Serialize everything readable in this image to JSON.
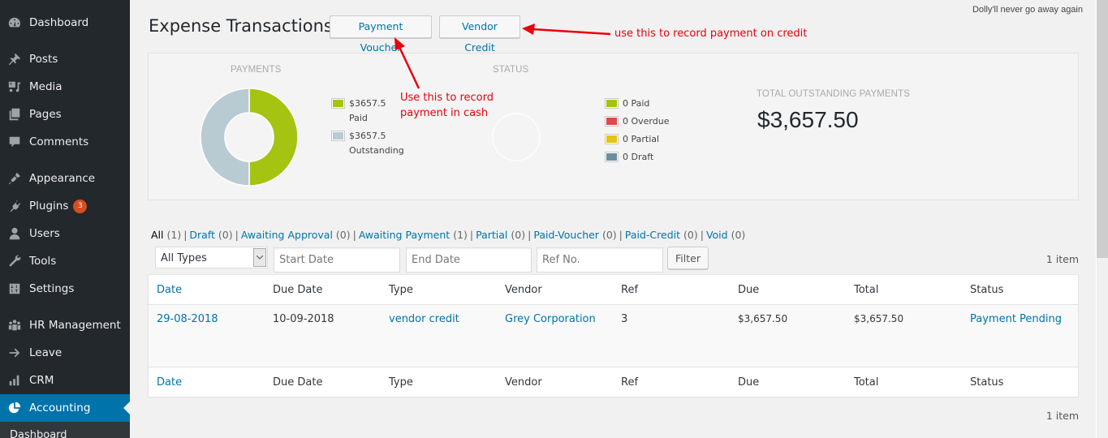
{
  "sidebar": {
    "items": [
      {
        "label": "Dashboard",
        "icon": "dashboard-icon"
      },
      {
        "label": "Posts",
        "icon": "pushpin-icon"
      },
      {
        "label": "Media",
        "icon": "media-icon"
      },
      {
        "label": "Pages",
        "icon": "pages-icon"
      },
      {
        "label": "Comments",
        "icon": "comment-icon"
      },
      {
        "label": "Appearance",
        "icon": "paintbrush-icon"
      },
      {
        "label": "Plugins",
        "icon": "plugin-icon",
        "badge": "3"
      },
      {
        "label": "Users",
        "icon": "user-icon"
      },
      {
        "label": "Tools",
        "icon": "wrench-icon"
      },
      {
        "label": "Settings",
        "icon": "sliders-icon"
      },
      {
        "label": "HR Management",
        "icon": "group-icon"
      },
      {
        "label": "Leave",
        "icon": "arrow-right-icon"
      },
      {
        "label": "CRM",
        "icon": "bar-chart-icon"
      },
      {
        "label": "Accounting",
        "icon": "pie-chart-icon",
        "active": true
      }
    ],
    "submenu_peek": "Dashboard"
  },
  "header": {
    "dolly_text": "Dolly'll never go away again",
    "title": "Expense Transactions",
    "buttons": {
      "payment_voucher": "Payment Voucher",
      "vendor_credit": "Vendor Credit"
    }
  },
  "annotations": {
    "credit": "use this to record payment on credit",
    "cash_line1": "Use this to record",
    "cash_line2": "payment in cash",
    "color": "#e8000b"
  },
  "summary": {
    "payments": {
      "title": "PAYMENTS",
      "legend": [
        {
          "amount": "$3657.5",
          "label": "Paid",
          "color": "#a4c411"
        },
        {
          "amount": "$3657.5",
          "label": "Outstanding",
          "color": "#b9cbd2"
        }
      ],
      "chart": [
        {
          "name": "Paid",
          "value": 3657.5,
          "color": "#a4c411"
        },
        {
          "name": "Outstanding",
          "value": 3657.5,
          "color": "#b9cbd2"
        }
      ]
    },
    "status": {
      "title": "STATUS",
      "legend": [
        {
          "label": "0 Paid",
          "color": "#a4c411"
        },
        {
          "label": "0 Overdue",
          "color": "#dd4b4b"
        },
        {
          "label": "0 Partial",
          "color": "#e3c313"
        },
        {
          "label": "0 Draft",
          "color": "#6b8ea1"
        }
      ]
    },
    "total_outstanding": {
      "title": "TOTAL OUTSTANDING PAYMENTS",
      "value": "$3,657.50"
    }
  },
  "filters": {
    "views": [
      {
        "label": "All",
        "count": "(1)",
        "current": true
      },
      {
        "label": "Draft",
        "count": "(0)"
      },
      {
        "label": "Awaiting Approval",
        "count": "(0)"
      },
      {
        "label": "Awaiting Payment",
        "count": "(1)"
      },
      {
        "label": "Partial",
        "count": "(0)"
      },
      {
        "label": "Paid-Voucher",
        "count": "(0)"
      },
      {
        "label": "Paid-Credit",
        "count": "(0)"
      },
      {
        "label": "Void",
        "count": "(0)"
      }
    ],
    "type_select": "All Types",
    "start_date_placeholder": "Start Date",
    "end_date_placeholder": "End Date",
    "ref_placeholder": "Ref No.",
    "filter_button": "Filter",
    "items_count": "1 item"
  },
  "table": {
    "columns": [
      "Date",
      "Due Date",
      "Type",
      "Vendor",
      "Ref",
      "Due",
      "Total",
      "Status"
    ],
    "rows": [
      {
        "date": "29-08-2018",
        "due_date": "10-09-2018",
        "type": "vendor credit",
        "vendor": "Grey Corporation",
        "ref": "3",
        "due": "$3,657.50",
        "total": "$3,657.50",
        "status": "Payment Pending"
      }
    ]
  }
}
